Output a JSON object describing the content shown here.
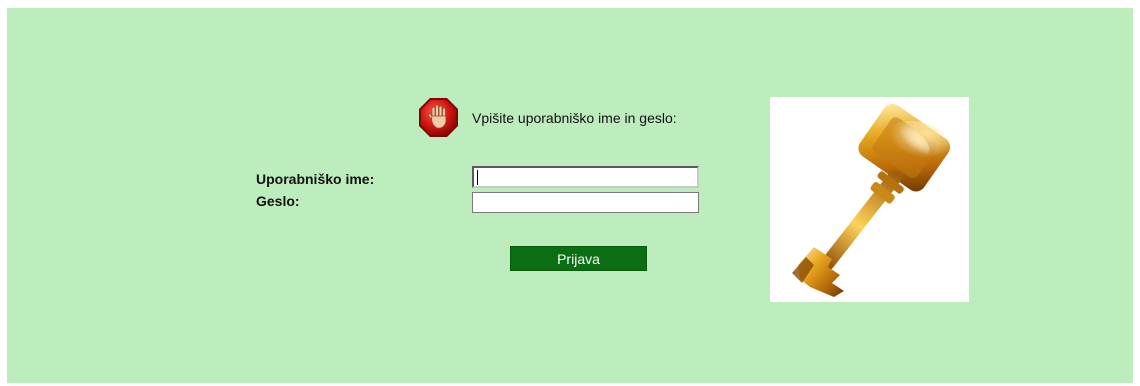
{
  "login": {
    "prompt": "Vpišite uporabniško ime in geslo:",
    "username_label": "Uporabniško ime:",
    "password_label": "Geslo:",
    "username_value": "",
    "password_value": "",
    "submit_label": "Prijava"
  },
  "icons": {
    "alert": "stop-hand-icon",
    "illustration": "key-icon"
  },
  "colors": {
    "background": "#bdecbd",
    "button": "#0c6e12",
    "button_text": "#ffffff"
  }
}
